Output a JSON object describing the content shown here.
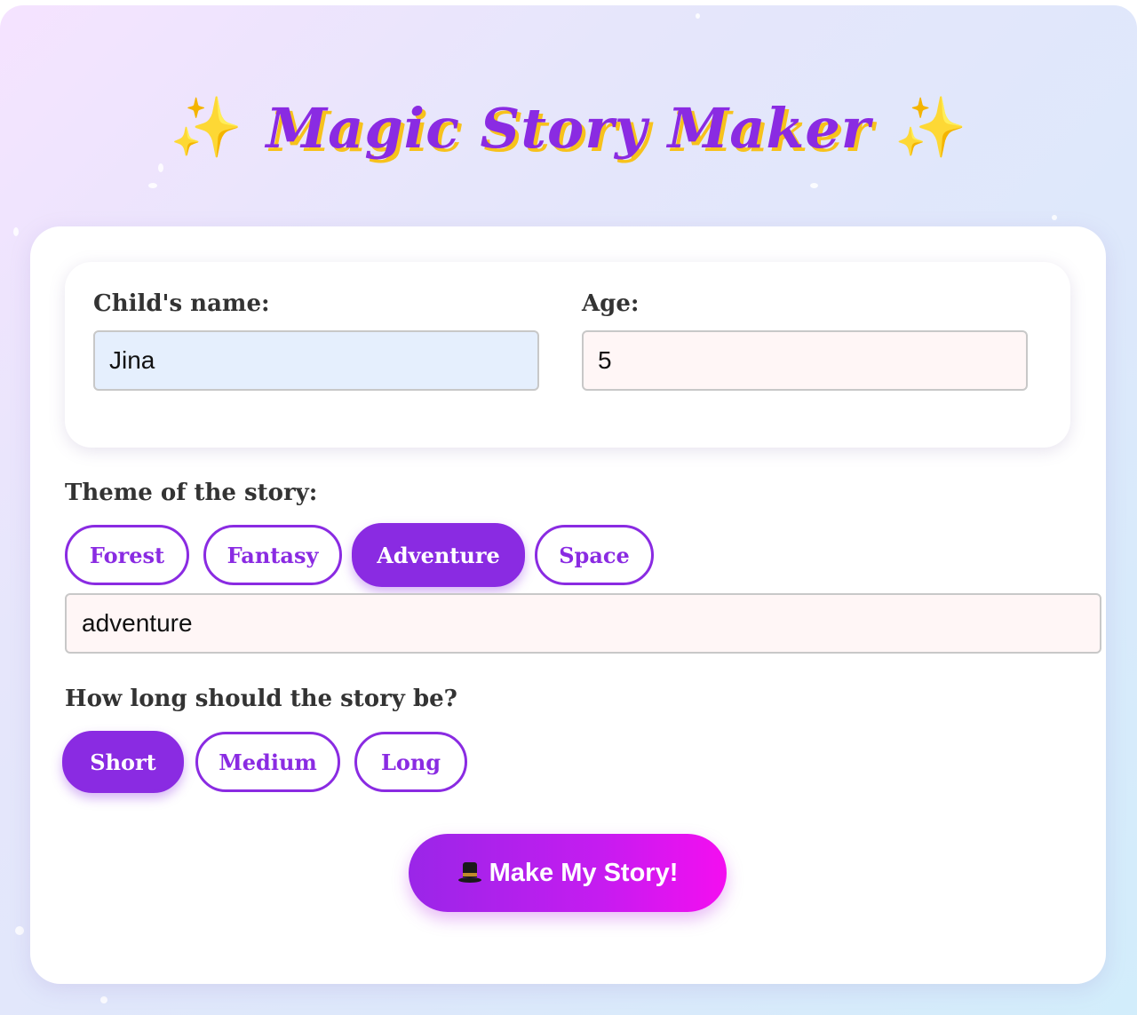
{
  "header": {
    "title": "Magic Story Maker",
    "left_icon": "sparkles-icon",
    "right_icon": "sparkles-icon"
  },
  "form": {
    "name_label": "Child's name:",
    "name_value": "Jina",
    "age_label": "Age:",
    "age_value": "5",
    "theme_label": "Theme of the story:",
    "themes": [
      "Forest",
      "Fantasy",
      "Adventure",
      "Space"
    ],
    "selected_theme": "Adventure",
    "theme_value": "adventure",
    "length_label": "How long should the story be?",
    "lengths": [
      "Short",
      "Medium",
      "Long"
    ],
    "selected_length": "Short",
    "submit_label": "Make My Story!",
    "submit_icon": "top-hat-icon"
  },
  "colors": {
    "accent": "#8a2be2",
    "title_shadow": "#f7c21c",
    "button_gradient_start": "#9a26e8",
    "button_gradient_end": "#f40ef0",
    "name_field_bg": "#e5effd",
    "age_field_bg": "#fff6f6"
  }
}
